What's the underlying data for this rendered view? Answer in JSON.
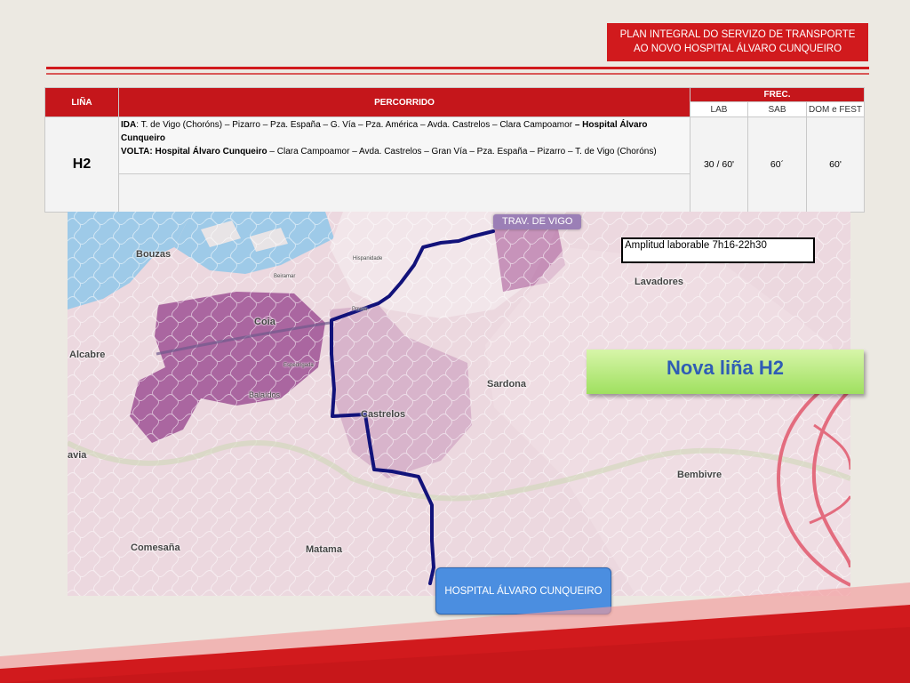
{
  "header": {
    "title_line1": "PLAN INTEGRAL DO SERVIZO  DE TRANSPORTE",
    "title_line2": "AO NOVO HOSPITAL ÁLVARO CUNQUEIRO"
  },
  "table": {
    "col_line": "LIÑA",
    "col_route": "PERCORRIDO",
    "col_freq": "FREC.",
    "col_lab": "LAB",
    "col_sab": "SAB",
    "col_dom": "DOM e FEST",
    "line": "H2",
    "ida_label": "IDA",
    "ida_text": ": T. de Vigo (Choróns) – Pizarro – Pza. España – G. Vía – Pza.  América – Avda. Castrelos – Clara Campoamor ",
    "ida_dest": "– Hospital Álvaro Cunqueiro",
    "volta_label": "VOLTA: Hospital Álvaro Cunqueiro",
    "volta_text": " – Clara Campoamor – Avda. Castrelos – Gran Vía – Pza. España – Pizarro – T. de Vigo (Choróns)",
    "freq_lab": "30 / 60'",
    "freq_sab": "60´",
    "freq_dom": "60'"
  },
  "map": {
    "labels": {
      "bouzas": "Bouzas",
      "coia": "Coia",
      "alcabre": "Alcabre",
      "balaidos": "Balaídos",
      "castrelos": "Castrelos",
      "sardona": "Sardona",
      "lavadores": "Lavadores",
      "bembivre": "Bembivre",
      "comesana": "Comesaña",
      "matama": "Matama",
      "avia": "avia",
      "beiramar": "Beiramar",
      "hispanidade": "Hispanidade",
      "povoa": "Povoa",
      "espedrigada": "Espedrigada"
    },
    "route_color": "#12127a"
  },
  "callouts": {
    "start": "TRAV. DE VIGO",
    "amplitude": "Amplitud laborable  7h16-22h30",
    "new_line": "Nova liña H2",
    "end": "HOSPITAL ÁLVARO CUNQUEIRO"
  },
  "colors": {
    "accent_red": "#d11a1d",
    "callout_green": "#9fe05f",
    "hospital_blue": "#4b8ee0"
  }
}
